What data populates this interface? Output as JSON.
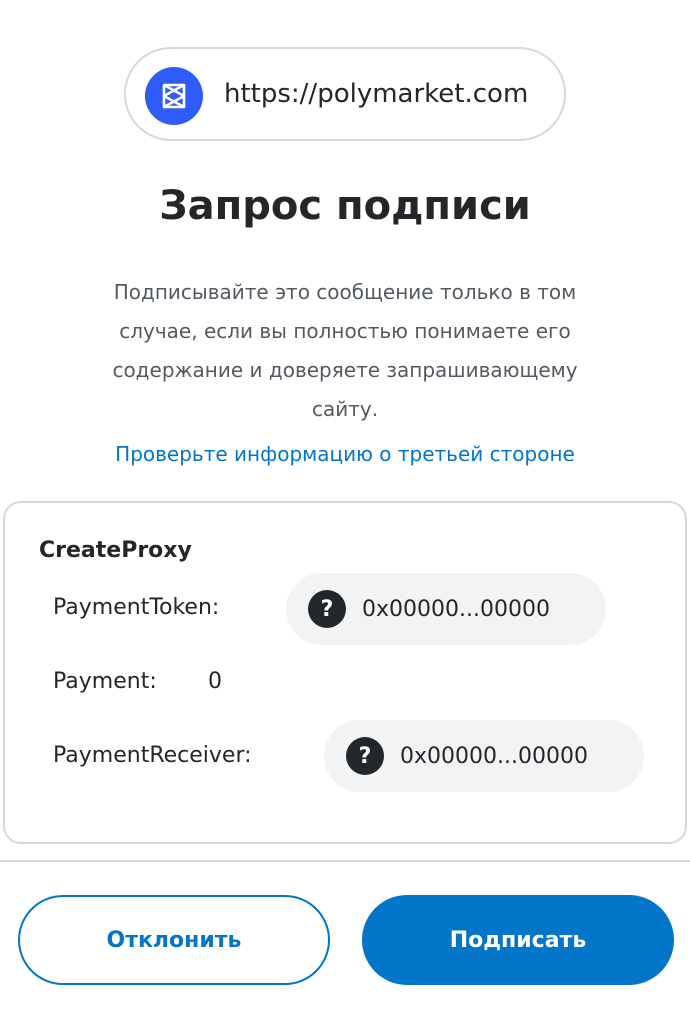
{
  "origin": {
    "url": "https://polymarket.com",
    "logo_icon": "polymarket-logo-icon",
    "logo_color": "#2f5dfb"
  },
  "title": "Запрос подписи",
  "description": "Подписывайте это сообщение только в том случае, если вы полностью понимаете его содержание и доверяете запрашивающему сайту.",
  "third_party_link": "Проверьте информацию о третьей стороне",
  "message": {
    "type": "CreateProxy",
    "fields": [
      {
        "label": "PaymentToken:",
        "value": "0x00000...00000",
        "icon": "question-icon"
      },
      {
        "label": "Payment:",
        "value": "0"
      },
      {
        "label": "PaymentReceiver:",
        "value": "0x00000...00000",
        "icon": "question-icon"
      }
    ]
  },
  "buttons": {
    "reject": "Отклонить",
    "sign": "Подписать"
  },
  "colors": {
    "accent": "#0376c9",
    "text": "#24272a",
    "muted": "#535a61",
    "border": "#d6d9dc",
    "pill_bg": "#f2f3f4"
  }
}
